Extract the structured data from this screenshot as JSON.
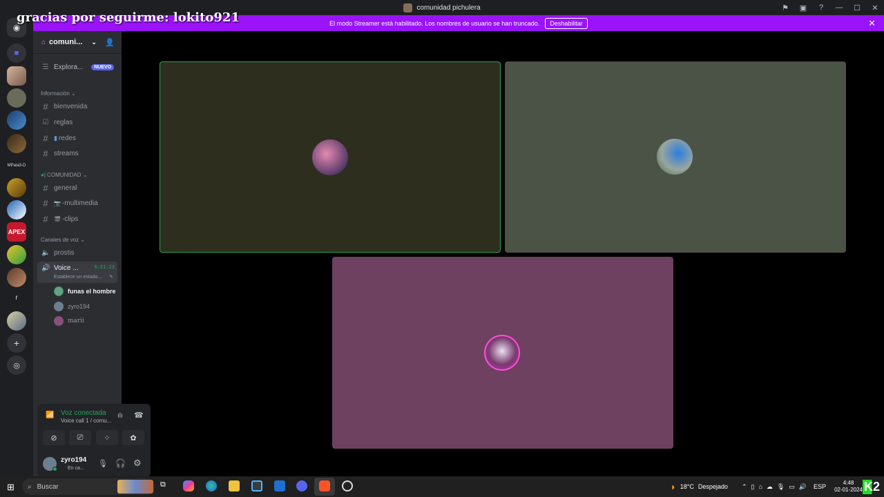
{
  "window": {
    "title": "comunidad pichulera"
  },
  "overlay": {
    "text": "gracias por seguirme: lokito921"
  },
  "notice": {
    "message": "El modo Streamer está habilitado. Los nombres de usuario se han truncado.",
    "button": "Deshabilitar"
  },
  "rail": {
    "label_mpaia": "MPaia3-D",
    "label_r": "r",
    "label_apex": "APEX"
  },
  "sidebar": {
    "server_name": "comuni...",
    "explore": {
      "label": "Explora...",
      "badge": "NUEVO"
    },
    "cat_info": "Información",
    "info_channels": [
      "bienvenida",
      "reglas",
      "redes",
      "streams"
    ],
    "cat_comunidad": "| COMUNIDAD",
    "community_channels": [
      "general",
      "-multimedia",
      "-clips"
    ],
    "cat_voice": "Canales de voz",
    "voice_channels": [
      {
        "name": "prostis"
      },
      {
        "name": "Voice ...",
        "time": "6:51:23",
        "status": "Establece un estado..."
      }
    ],
    "voice_users": [
      "funas el hombre",
      "zyro194",
      "marii"
    ]
  },
  "voice_panel": {
    "status": "Voz conectada",
    "channel": "Voice call 1 / comu..."
  },
  "user": {
    "name": "zyro194",
    "status": "En ca..."
  },
  "tiles": [
    {
      "bg": "#2e2e1f",
      "border": "#23a55a"
    },
    {
      "bg": "#4b5246"
    },
    {
      "bg": "#6e4160"
    }
  ],
  "taskbar": {
    "search": "Buscar",
    "weather_temp": "18°C",
    "weather_text": "Despejado",
    "lang": "ESP",
    "time": "4:48",
    "date": "02-01-2024"
  }
}
